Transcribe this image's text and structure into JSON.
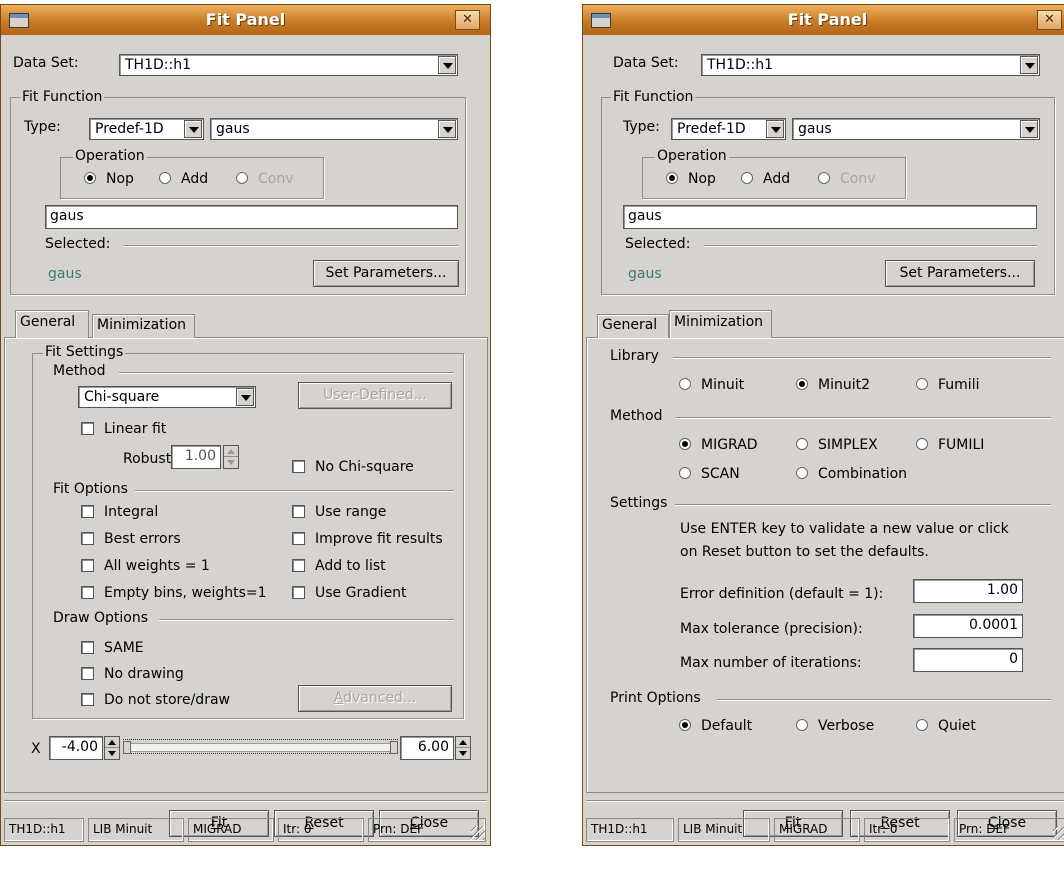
{
  "left": {
    "title": "Fit Panel",
    "data_set_label": "Data Set:",
    "data_set_value": "TH1D::h1",
    "fit_function_label": "Fit Function",
    "type_label": "Type:",
    "type_value": "Predef-1D",
    "function_value": "gaus",
    "operation_label": "Operation",
    "op_nop": "Nop",
    "op_add": "Add",
    "op_conv": "Conv",
    "formula_value": "gaus",
    "selected_label": "Selected:",
    "selected_value": "gaus",
    "set_params": "Set Parameters...",
    "tab_general": "General",
    "tab_minimization": "Minimization",
    "fit_settings_label": "Fit Settings",
    "method_label": "Method",
    "method_value": "Chi-square",
    "user_defined": "User-Defined...",
    "linear_fit": "Linear fit",
    "robust_label": "Robust:",
    "robust_value": "1.00",
    "no_chi_square": "No Chi-square",
    "fit_options_label": "Fit Options",
    "opt_integral": "Integral",
    "opt_use_range": "Use range",
    "opt_best_errors": "Best errors",
    "opt_improve": "Improve fit results",
    "opt_all_weights": "All weights = 1",
    "opt_add_list": "Add to list",
    "opt_empty_bins": "Empty bins, weights=1",
    "opt_use_gradient": "Use Gradient",
    "draw_options_label": "Draw Options",
    "draw_same": "SAME",
    "draw_no_drawing": "No drawing",
    "draw_not_store": "Do not store/draw",
    "advanced_pre": "",
    "advanced_u": "A",
    "advanced_post": "dvanced...",
    "x_label": "X",
    "x_min": "-4.00",
    "x_max": "6.00",
    "btn_fit_u": "F",
    "btn_fit_rest": "it",
    "btn_reset_u": "R",
    "btn_reset_rest": "eset",
    "btn_close_u": "C",
    "btn_close_rest": "lose",
    "status": [
      "TH1D::h1",
      "LIB Minuit",
      "MIGRAD",
      "Itr: 0",
      "Prn: DEF"
    ]
  },
  "right": {
    "title": "Fit Panel",
    "data_set_label": "Data Set:",
    "data_set_value": "TH1D::h1",
    "fit_function_label": "Fit Function",
    "type_label": "Type:",
    "type_value": "Predef-1D",
    "function_value": "gaus",
    "operation_label": "Operation",
    "op_nop": "Nop",
    "op_add": "Add",
    "op_conv": "Conv",
    "formula_value": "gaus",
    "selected_label": "Selected:",
    "selected_value": "gaus",
    "set_params": "Set Parameters...",
    "tab_general": "General",
    "tab_minimization": "Minimization",
    "library_label": "Library",
    "lib_minuit": "Minuit",
    "lib_minuit2": "Minuit2",
    "lib_fumili": "Fumili",
    "method_label": "Method",
    "m_migrad": "MIGRAD",
    "m_simplex": "SIMPLEX",
    "m_fumili": "FUMILI",
    "m_scan": "SCAN",
    "m_combination": "Combination",
    "settings_label": "Settings",
    "settings_help_1": "Use ENTER key to validate a new value or click",
    "settings_help_2": "on Reset button to set the defaults.",
    "error_def_label": "Error definition (default = 1):",
    "error_def_value": "1.00",
    "max_tol_label": "Max tolerance (precision):",
    "max_tol_value": "0.0001",
    "max_iter_label": "Max number of iterations:",
    "max_iter_value": "0",
    "print_options_label": "Print Options",
    "p_default": "Default",
    "p_verbose": "Verbose",
    "p_quiet": "Quiet",
    "btn_fit_u": "F",
    "btn_fit_rest": "it",
    "btn_reset_u": "R",
    "btn_reset_rest": "eset",
    "btn_close_u": "C",
    "btn_close_rest": "lose",
    "status": [
      "TH1D::h1",
      "LIB Minuit",
      "MIGRAD",
      "Itr: 0",
      "Prn: DEF"
    ]
  }
}
